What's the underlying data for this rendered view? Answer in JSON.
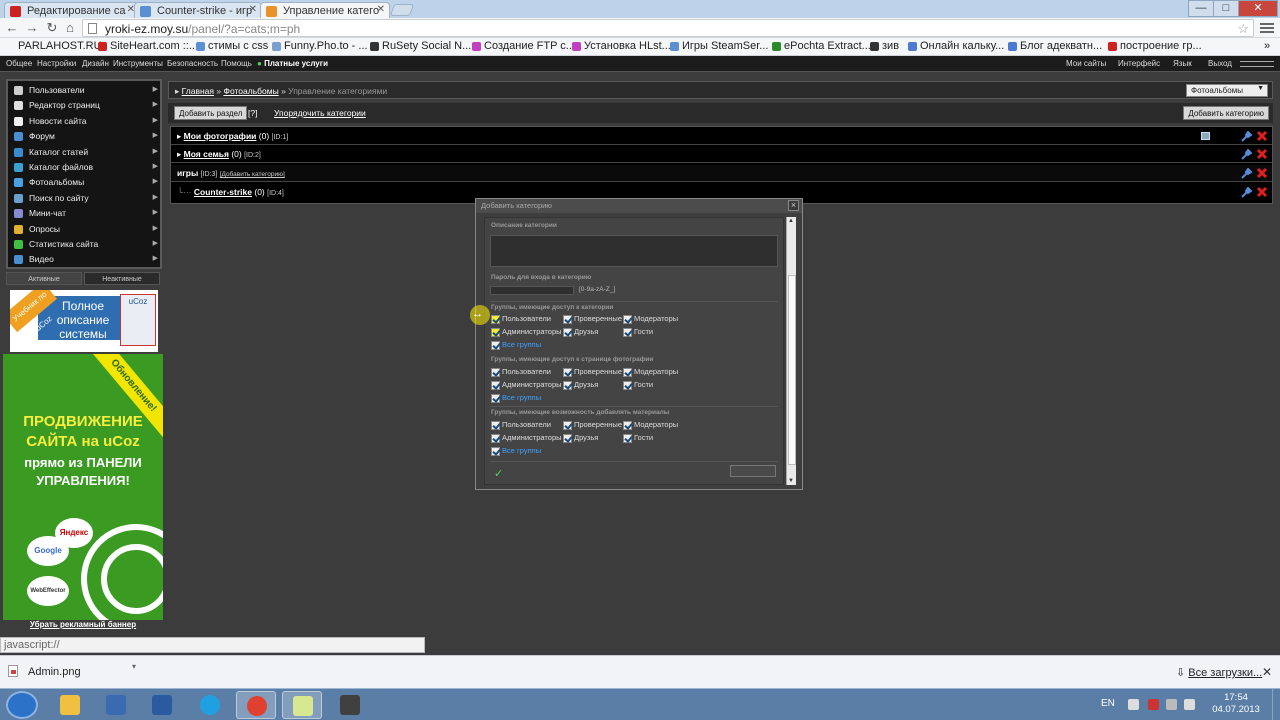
{
  "tabs": [
    {
      "title": "Редактирование са",
      "icon": "youtube-icon",
      "color": "#cc2222"
    },
    {
      "title": "Counter-strike - игр",
      "icon": "ucoz-icon",
      "color": "#5b8fd1"
    },
    {
      "title": "Управление катего",
      "icon": "ucoz-icon",
      "color": "#e8932a"
    }
  ],
  "window_controls": {
    "minimize": "—",
    "maximize": "□",
    "close": "✕"
  },
  "address": {
    "host": "yroki-ez.moy.su",
    "path": "/panel/?a=cats;m=ph"
  },
  "bookmarks": [
    {
      "label": "PARLAHOST.RU",
      "color": ""
    },
    {
      "label": "SiteHeart.com ::...",
      "color": "#cc2222"
    },
    {
      "label": "стимы с css",
      "color": "#5b8fd1"
    },
    {
      "label": "Funny.Pho.to - ...",
      "color": "#7aa0d0"
    },
    {
      "label": "RuSety Social N...",
      "color": "#333333"
    },
    {
      "label": "Создание FTP с...",
      "color": "#c040c0"
    },
    {
      "label": "Установка HLst...",
      "color": "#c040c0"
    },
    {
      "label": "Игры SteamSer...",
      "color": "#5b8fd1"
    },
    {
      "label": "ePochta Extract...",
      "color": "#2a8a2a"
    },
    {
      "label": "зив",
      "color": "#333333"
    },
    {
      "label": "Онлайн кальку...",
      "color": "#4c7ad0"
    },
    {
      "label": "Блог адекватн...",
      "color": "#4c7ad0"
    },
    {
      "label": "построение гр...",
      "color": "#cc2222"
    }
  ],
  "site_menu": [
    "Общее",
    "Настройки",
    "Дизайн",
    "Инструменты",
    "Безопасность",
    "Помощь"
  ],
  "site_paid": "Платные услуги",
  "site_right": [
    "Мои сайты",
    "Интерфейс",
    "Язык",
    "Выход"
  ],
  "sidebar": {
    "items": [
      {
        "label": "Пользователи",
        "icon": "users-icon",
        "color": "#cfcfcf"
      },
      {
        "label": "Редактор страниц",
        "icon": "pages-icon",
        "color": "#e0e0e0"
      },
      {
        "label": "Новости сайта",
        "icon": "news-icon",
        "color": "#f0f0f0"
      },
      {
        "label": "Форум",
        "icon": "forum-icon",
        "color": "#4a90d0"
      },
      {
        "label": "Каталог статей",
        "icon": "articles-icon",
        "color": "#3a8ad0"
      },
      {
        "label": "Каталог файлов",
        "icon": "files-icon",
        "color": "#3aa0d0"
      },
      {
        "label": "Фотоальбомы",
        "icon": "photo-icon",
        "color": "#4aa0e0"
      },
      {
        "label": "Поиск по сайту",
        "icon": "search-icon",
        "color": "#6aa0d0"
      },
      {
        "label": "Мини-чат",
        "icon": "chat-icon",
        "color": "#8a8ad0"
      },
      {
        "label": "Опросы",
        "icon": "polls-icon",
        "color": "#e0b030"
      },
      {
        "label": "Статистика сайта",
        "icon": "stats-icon",
        "color": "#40c040"
      },
      {
        "label": "Видео",
        "icon": "video-icon",
        "color": "#4a90d0"
      }
    ],
    "tabs": [
      "Активные",
      "Неактивные"
    ]
  },
  "banner1": {
    "ribbon": "Учебник по uCoz",
    "main": "Полное описание системы",
    "side": "uCoz"
  },
  "banner2": {
    "stripe": "Обновление!",
    "title": "ПРОДВИЖЕНИЕ САЙТА на uCoz",
    "sub": "прямо из ПАНЕЛИ УПРАВЛЕНИЯ!",
    "logos": [
      "Яндекс",
      "Google",
      "WebEffector"
    ]
  },
  "remove_banner": "Убрать рекламный баннер",
  "breadcrumb": {
    "home": "Главная",
    "albums": "Фотоальбомы",
    "current": "Управление категориями",
    "sep": "»"
  },
  "album_select": "Фотоальбомы",
  "actions": {
    "add_section": "Добавить раздел",
    "help": "[?]",
    "sort": "Упорядочить категории",
    "add_category": "Добавить категорию"
  },
  "categories": [
    {
      "name": "Мои фотографии",
      "count": "(0)",
      "id": "[ID:1]"
    },
    {
      "name": "Моя семья",
      "count": "(0)",
      "id": "[ID:2]"
    },
    {
      "name": "игры",
      "id": "[ID:3]",
      "add_link": "[Добавить категорию]"
    },
    {
      "name": "Counter-strike",
      "count": "(0)",
      "id": "[ID:4]"
    }
  ],
  "dialog": {
    "title": "Добавить категорию",
    "desc_label": "Описание категории",
    "pw_label": "Пароль для входа в категорию",
    "pw_hint": "[0-9a-zA-Z_]",
    "groups1_label": "Группы, имеющие доступ к категории",
    "groups2_label": "Группы, имеющие доступ к странице фотографии",
    "groups3_label": "Группы, имеющие возможность добавлять материалы",
    "groups": [
      "Пользователи",
      "Проверенные",
      "Модераторы",
      "Администраторы",
      "Друзья",
      "Гости"
    ],
    "all_groups": "Все группы",
    "ok_mark": "✓"
  },
  "status_text": "javascript://",
  "download": {
    "file": "Admin.png",
    "all": "Все загрузки...",
    "close": "✕"
  },
  "tray": {
    "lang": "EN",
    "time": "17:54",
    "date": "04.07.2013"
  },
  "taskbar_apps": [
    {
      "icon": "explorer-icon",
      "color": "#f0c040"
    },
    {
      "icon": "server-manager-icon",
      "color": "#3a6ab0"
    },
    {
      "icon": "word-icon",
      "color": "#2a5aa0"
    },
    {
      "icon": "skype-icon",
      "color": "#20a0e0"
    },
    {
      "icon": "chrome-icon",
      "color": "#e04030"
    },
    {
      "icon": "notepad-icon",
      "color": "#d8e890"
    },
    {
      "icon": "cs-icon",
      "color": "#404040"
    }
  ]
}
